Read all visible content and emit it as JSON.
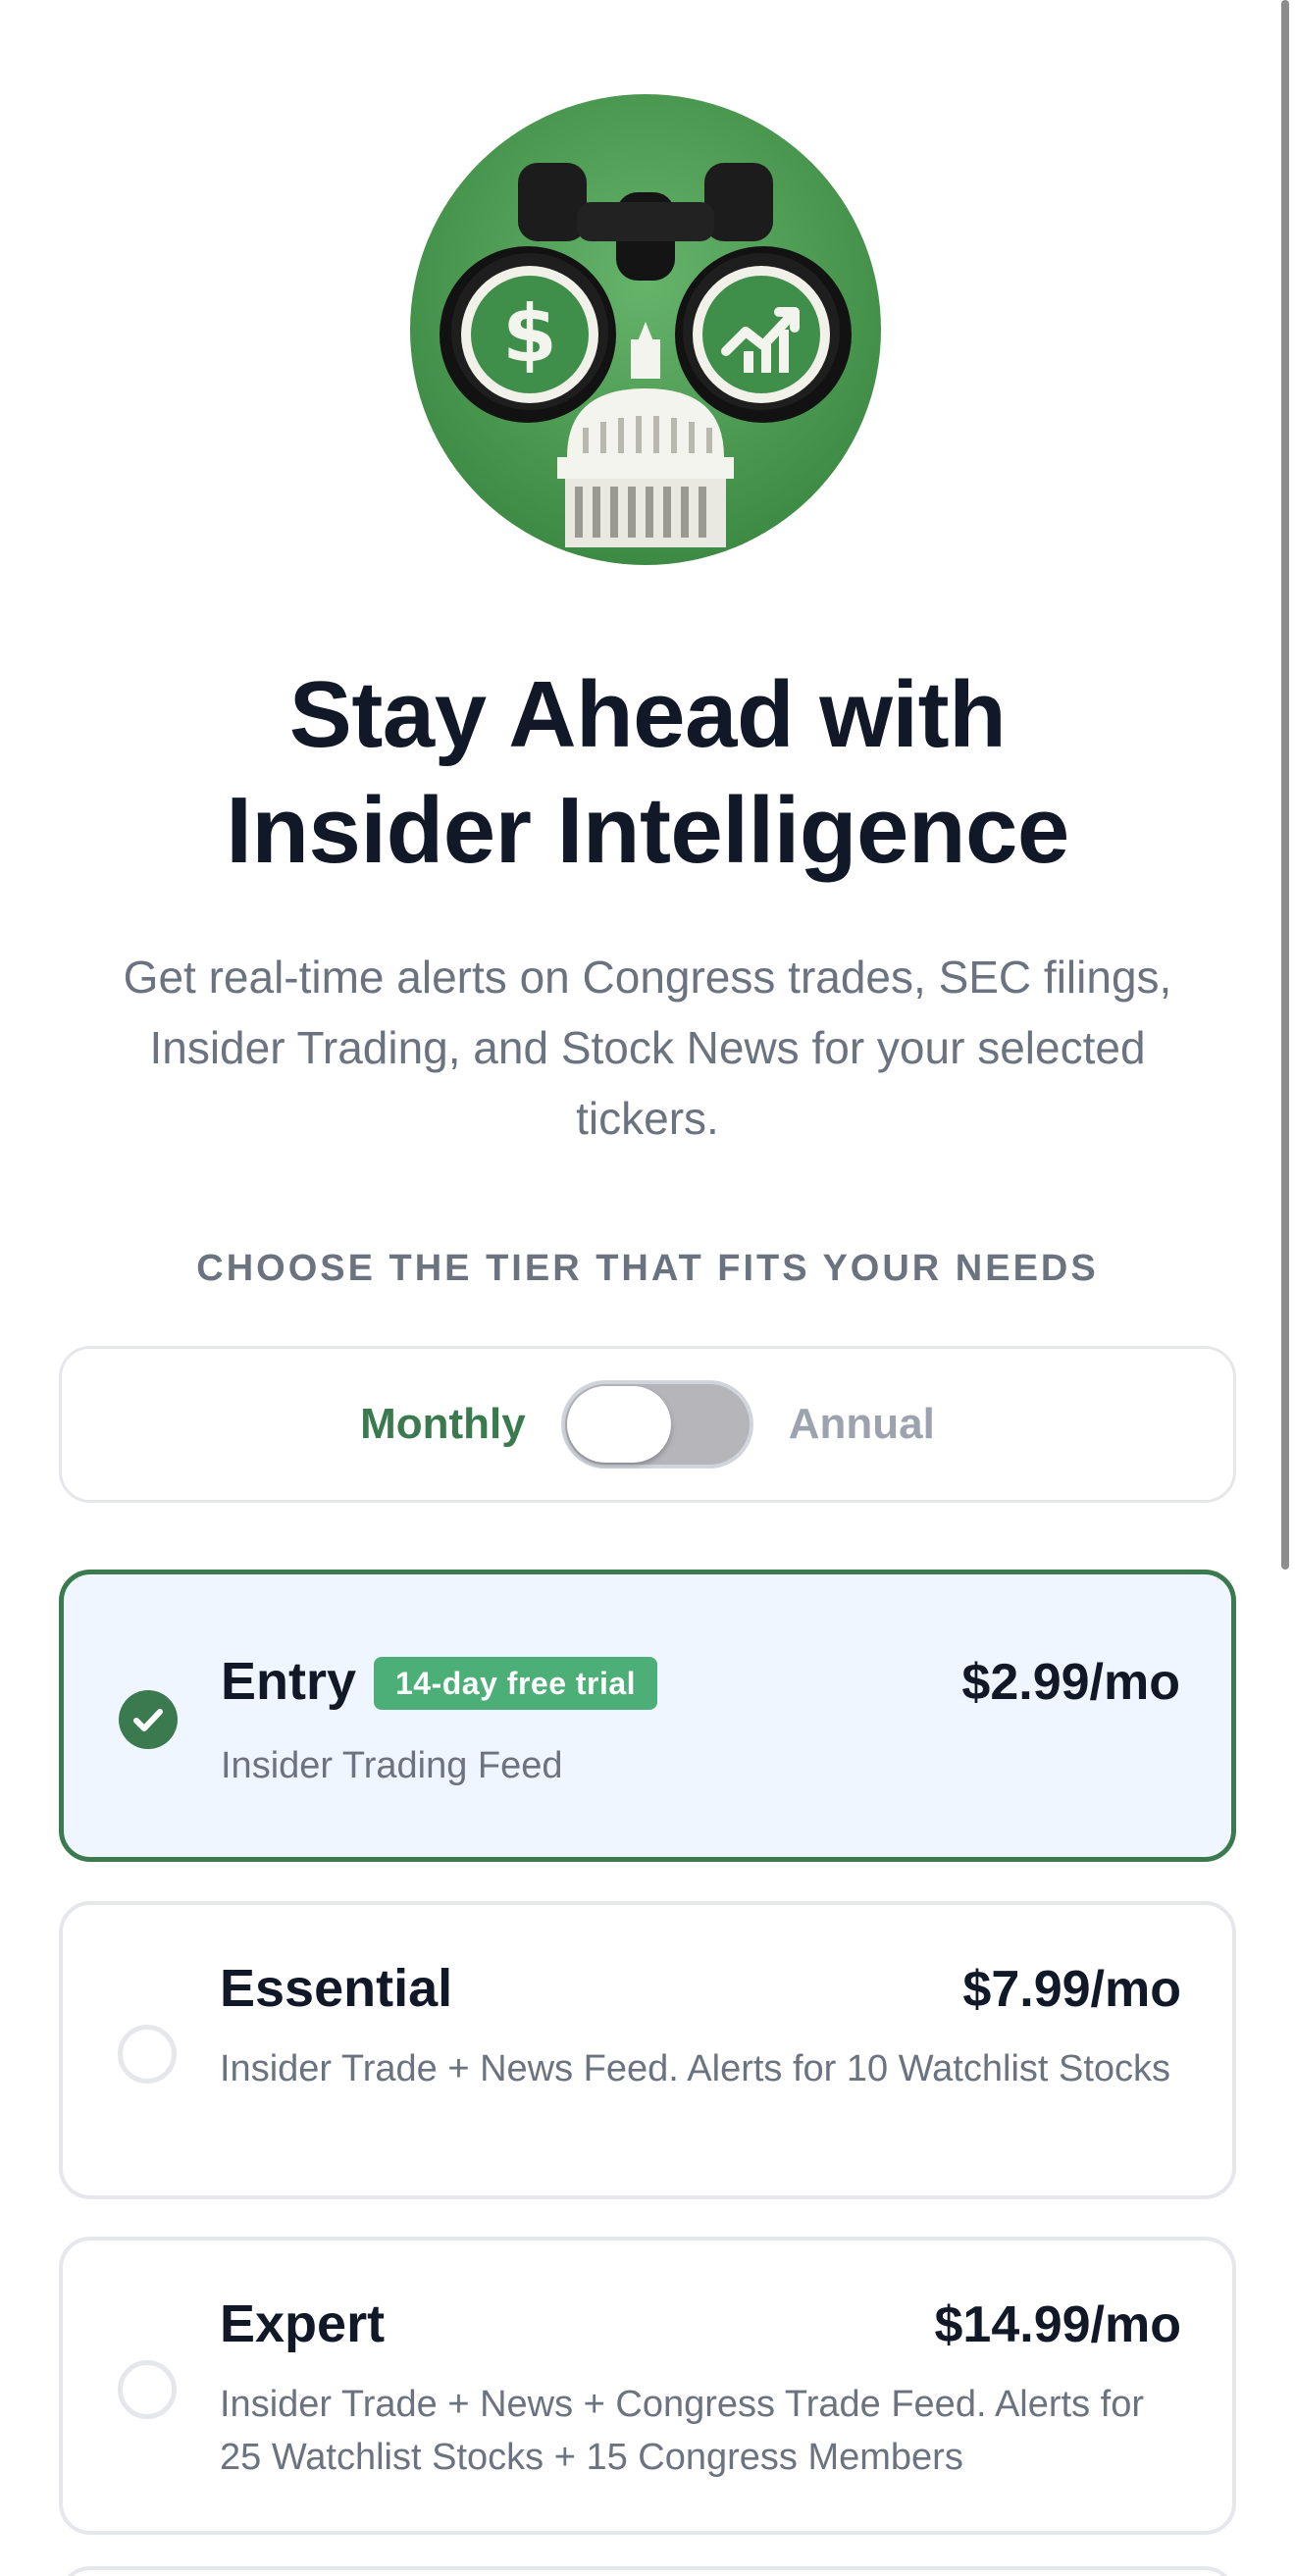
{
  "app": {
    "logo_icon": "binoculars-capitol-icon",
    "brand_color": "#3a7a4e"
  },
  "hero": {
    "title_line1": "Stay Ahead with",
    "title_line2": "Insider Intelligence",
    "subtitle": "Get real-time alerts on Congress trades, SEC filings, Insider Trading, and Stock News for your selected tickers."
  },
  "section": {
    "label": "CHOOSE THE TIER THAT FITS YOUR NEEDS"
  },
  "billing": {
    "monthly_label": "Monthly",
    "annual_label": "Annual",
    "selected": "Monthly"
  },
  "tiers": [
    {
      "name": "Entry",
      "badge": "14-day free trial",
      "price": "$2.99/mo",
      "description": "Insider Trading Feed",
      "selected": true
    },
    {
      "name": "Essential",
      "badge": "",
      "price": "$7.99/mo",
      "description": "Insider Trade + News Feed. Alerts for 10 Watchlist Stocks",
      "selected": false
    },
    {
      "name": "Expert",
      "badge": "",
      "price": "$14.99/mo",
      "description": "Insider Trade + News + Congress Trade Feed. Alerts for 25 Watchlist Stocks + 15 Congress Members",
      "selected": false
    }
  ]
}
